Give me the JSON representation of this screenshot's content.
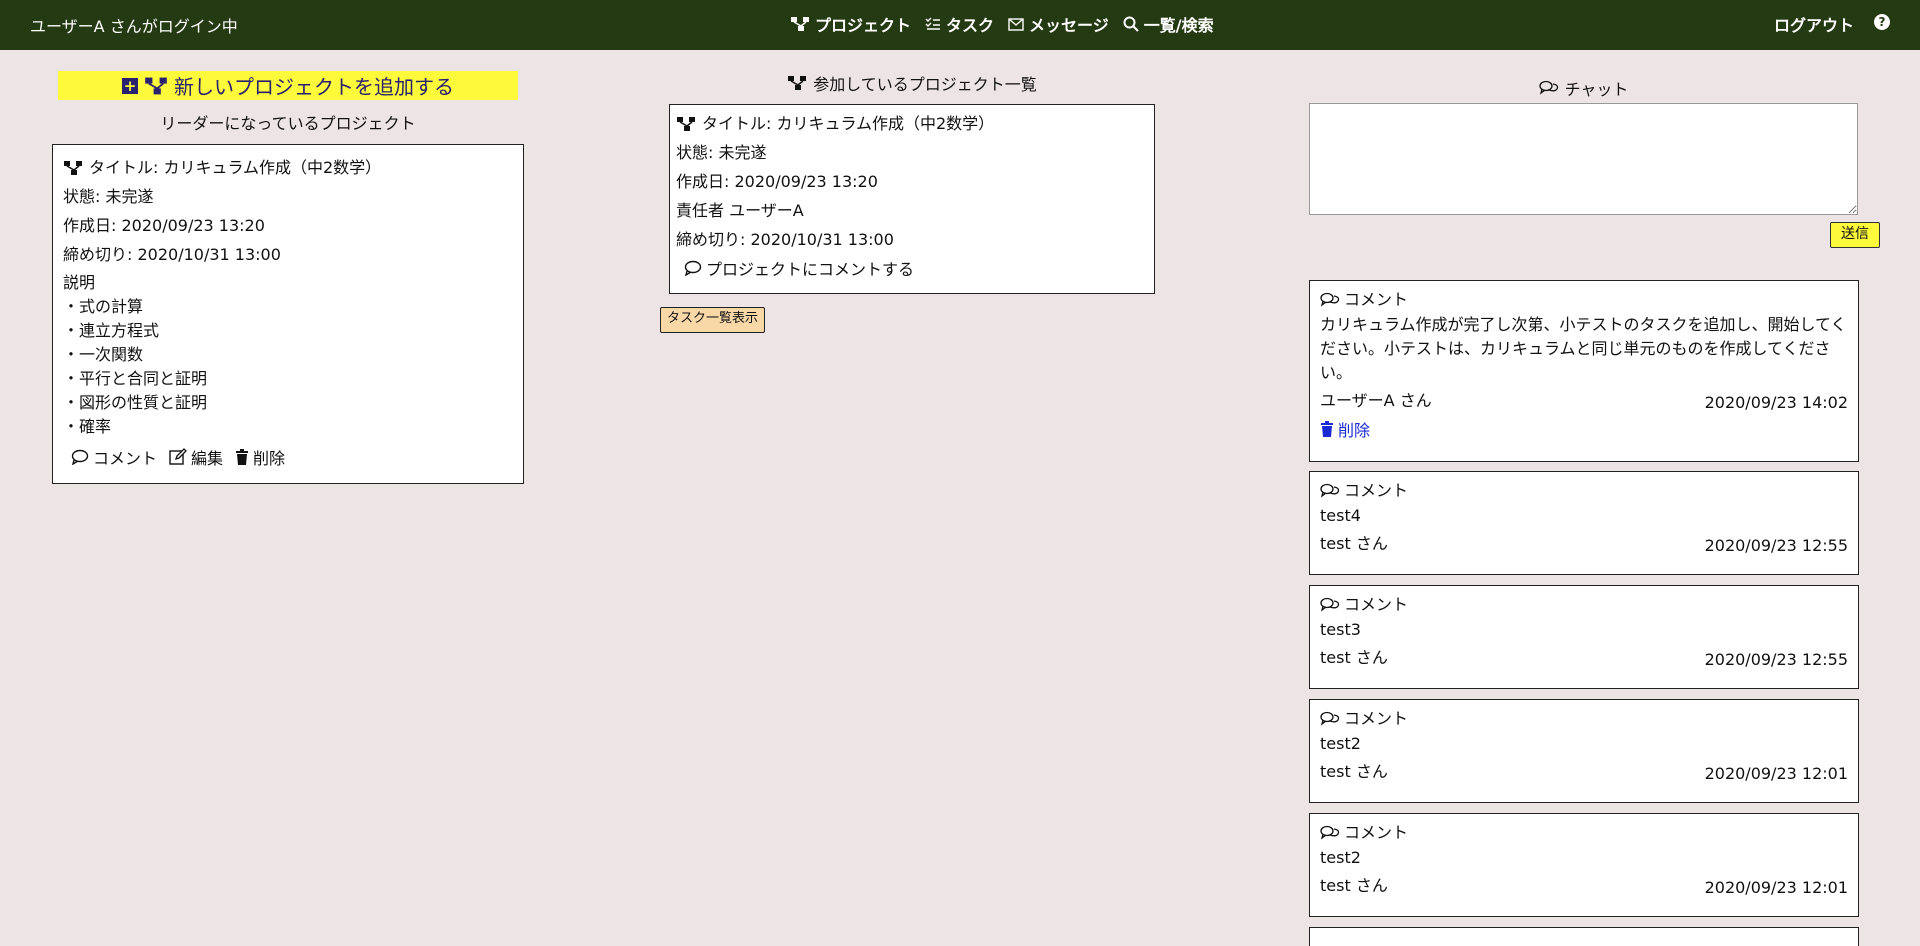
{
  "header": {
    "login_status": "ユーザーA さんがログイン中",
    "nav": [
      {
        "label": "プロジェクト",
        "icon": "project-tree-icon"
      },
      {
        "label": "タスク",
        "icon": "task-list-icon"
      },
      {
        "label": "メッセージ",
        "icon": "envelope-icon"
      },
      {
        "label": "一覧/検索",
        "icon": "search-icon"
      }
    ],
    "logout": "ログアウト",
    "help": "?"
  },
  "left": {
    "add_button": "新しいプロジェクトを追加する",
    "section_title": "リーダーになっているプロジェクト",
    "card": {
      "title": "タイトル: カリキュラム作成（中2数学）",
      "status": "状態: 未完遂",
      "created": "作成日: 2020/09/23 13:20",
      "deadline": "締め切り: 2020/10/31 13:00",
      "desc_label": "説明",
      "desc_lines": [
        "・式の計算",
        "・連立方程式",
        "・一次関数",
        "・平行と合同と証明",
        "・図形の性質と証明",
        "・確率"
      ],
      "actions": {
        "comment": "コメント",
        "edit": "編集",
        "delete": "削除"
      }
    }
  },
  "middle": {
    "section_title": "参加しているプロジェクト一覧",
    "card": {
      "title": "タイトル: カリキュラム作成（中2数学）",
      "status": "状態: 未完遂",
      "created": "作成日: 2020/09/23 13:20",
      "owner": "責任者 ユーザーA",
      "deadline": "締め切り: 2020/10/31 13:00",
      "comment_link": "プロジェクトにコメントする"
    },
    "task_button": "タスク一覧表示"
  },
  "right": {
    "section_title": "チャット",
    "send_button": "送信",
    "comments": [
      {
        "head": "コメント",
        "body": "カリキュラム作成が完了し次第、小テストのタスクを追加し、開始してください。小テストは、カリキュラムと同じ単元のものを作成してください。",
        "user": "ユーザーA さん",
        "date": "2020/09/23 14:02",
        "delete": "削除"
      },
      {
        "head": "コメント",
        "body": "test4",
        "user": "test さん",
        "date": "2020/09/23 12:55"
      },
      {
        "head": "コメント",
        "body": "test3",
        "user": "test さん",
        "date": "2020/09/23 12:55"
      },
      {
        "head": "コメント",
        "body": "test2",
        "user": "test さん",
        "date": "2020/09/23 12:01"
      },
      {
        "head": "コメント",
        "body": "test2",
        "user": "test さん",
        "date": "2020/09/23 12:01"
      }
    ]
  }
}
